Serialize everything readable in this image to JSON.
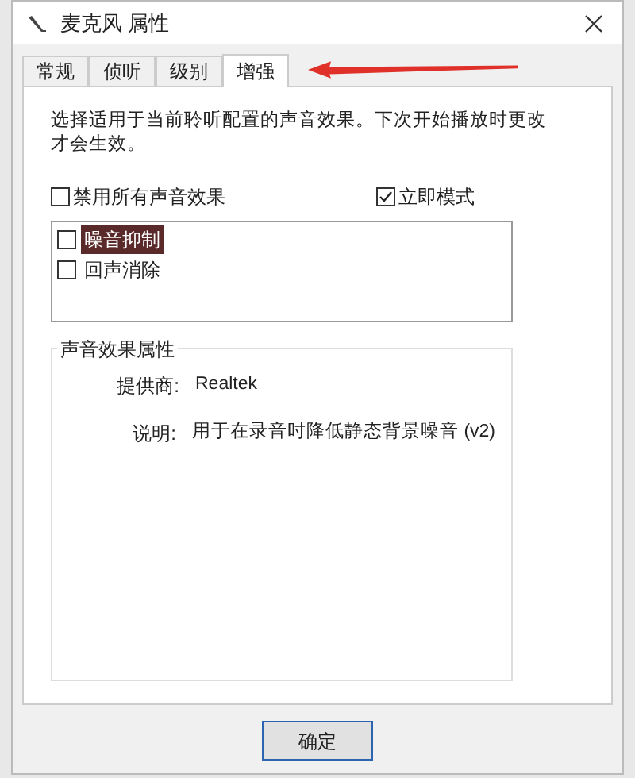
{
  "window": {
    "title": "麦克风 属性"
  },
  "tabs": [
    {
      "label": "常规",
      "selected": false
    },
    {
      "label": "侦听",
      "selected": false
    },
    {
      "label": "级别",
      "selected": false
    },
    {
      "label": "增强",
      "selected": true
    }
  ],
  "description": "选择适用于当前聆听配置的声音效果。下次开始播放时更改才会生效。",
  "options": [
    {
      "label": "禁用所有声音效果",
      "checked": false
    },
    {
      "label": "立即模式",
      "checked": true
    }
  ],
  "effects": [
    {
      "label": "噪音抑制",
      "checked": false,
      "selected": true
    },
    {
      "label": "回声消除",
      "checked": false,
      "selected": false
    }
  ],
  "properties": {
    "title": "声音效果属性",
    "rows": [
      {
        "label": "提供商:",
        "value": "Realtek"
      },
      {
        "label": "说明:",
        "value": "用于在录音时降低静态背景噪音 (v2)"
      }
    ]
  },
  "buttons": [
    "确定"
  ]
}
